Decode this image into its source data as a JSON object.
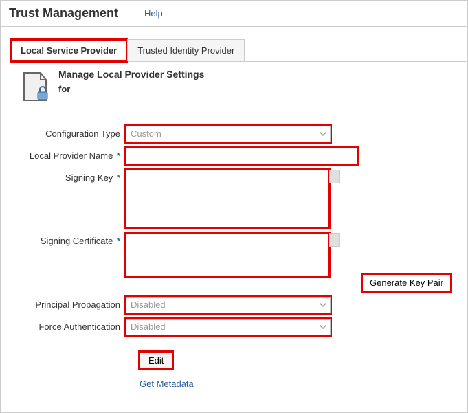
{
  "header": {
    "title": "Trust Management",
    "help": "Help"
  },
  "tabs": {
    "local": "Local Service Provider",
    "trusted": "Trusted Identity Provider"
  },
  "subheader": {
    "title": "Manage Local Provider Settings",
    "for": "for"
  },
  "form": {
    "config_type": {
      "label": "Configuration Type",
      "value": "Custom"
    },
    "local_provider_name": {
      "label": "Local Provider Name",
      "value": ""
    },
    "signing_key": {
      "label": "Signing Key",
      "value": ""
    },
    "signing_certificate": {
      "label": "Signing Certificate",
      "value": ""
    },
    "principal_propagation": {
      "label": "Principal Propagation",
      "value": "Disabled"
    },
    "force_auth": {
      "label": "Force Authentication",
      "value": "Disabled"
    },
    "generate_key_pair": "Generate Key Pair",
    "edit": "Edit",
    "get_metadata": "Get Metadata"
  }
}
